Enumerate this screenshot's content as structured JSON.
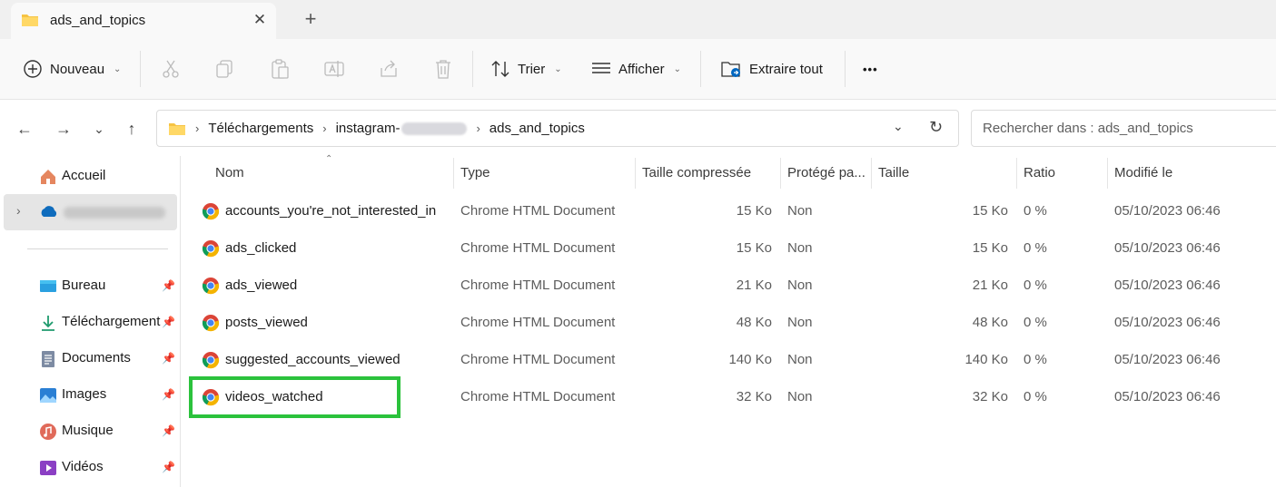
{
  "tab": {
    "title": "ads_and_topics",
    "close_glyph": "✕",
    "new_glyph": "+"
  },
  "toolbar": {
    "new_label": "Nouveau",
    "sort_label": "Trier",
    "view_label": "Afficher",
    "extract_label": "Extraire tout",
    "more_glyph": "•••"
  },
  "nav": {
    "breadcrumbs": [
      "Téléchargements",
      "instagram-",
      "ads_and_topics"
    ],
    "search_placeholder": "Rechercher dans : ads_and_topics"
  },
  "sidebar": {
    "home_label": "Accueil",
    "items": [
      {
        "label": "Bureau",
        "icon": "desktop-icon"
      },
      {
        "label": "Téléchargement",
        "icon": "download-icon"
      },
      {
        "label": "Documents",
        "icon": "document-icon"
      },
      {
        "label": "Images",
        "icon": "image-icon"
      },
      {
        "label": "Musique",
        "icon": "music-icon"
      },
      {
        "label": "Vidéos",
        "icon": "video-icon"
      }
    ]
  },
  "columns": [
    "Nom",
    "Type",
    "Taille compressée",
    "Protégé pa...",
    "Taille",
    "Ratio",
    "Modifié le"
  ],
  "files": [
    {
      "name": "accounts_you're_not_interested_in",
      "type": "Chrome HTML Document",
      "compressed": "15 Ko",
      "protected": "Non",
      "size": "15 Ko",
      "ratio": "0 %",
      "modified": "05/10/2023 06:46"
    },
    {
      "name": "ads_clicked",
      "type": "Chrome HTML Document",
      "compressed": "15 Ko",
      "protected": "Non",
      "size": "15 Ko",
      "ratio": "0 %",
      "modified": "05/10/2023 06:46"
    },
    {
      "name": "ads_viewed",
      "type": "Chrome HTML Document",
      "compressed": "21 Ko",
      "protected": "Non",
      "size": "21 Ko",
      "ratio": "0 %",
      "modified": "05/10/2023 06:46"
    },
    {
      "name": "posts_viewed",
      "type": "Chrome HTML Document",
      "compressed": "48 Ko",
      "protected": "Non",
      "size": "48 Ko",
      "ratio": "0 %",
      "modified": "05/10/2023 06:46"
    },
    {
      "name": "suggested_accounts_viewed",
      "type": "Chrome HTML Document",
      "compressed": "140 Ko",
      "protected": "Non",
      "size": "140 Ko",
      "ratio": "0 %",
      "modified": "05/10/2023 06:46"
    },
    {
      "name": "videos_watched",
      "type": "Chrome HTML Document",
      "compressed": "32 Ko",
      "protected": "Non",
      "size": "32 Ko",
      "ratio": "0 %",
      "modified": "05/10/2023 06:46"
    }
  ],
  "colors": {
    "highlight": "#2bc23c",
    "accent": "#0067c0"
  }
}
